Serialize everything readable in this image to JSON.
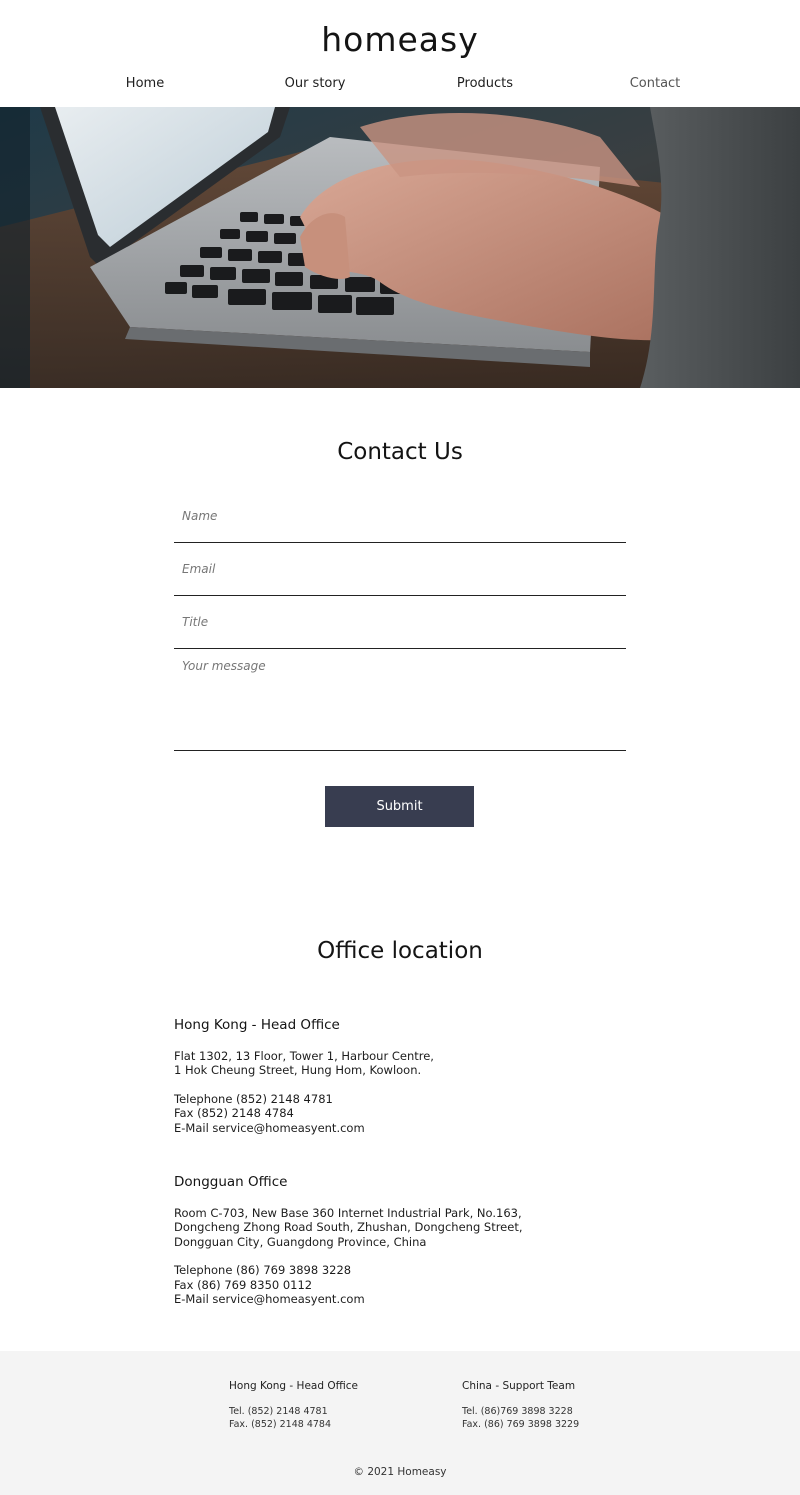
{
  "brand": {
    "logo": "homeasy"
  },
  "nav": {
    "items": [
      {
        "label": "Home"
      },
      {
        "label": "Our story"
      },
      {
        "label": "Products"
      },
      {
        "label": "Contact"
      }
    ]
  },
  "hero": {
    "alt": "hands typing on a laptop keyboard"
  },
  "contact": {
    "title": "Contact Us",
    "fields": {
      "name_placeholder": "Name",
      "email_placeholder": "Email",
      "title_placeholder": "Title",
      "message_placeholder": "Your message"
    },
    "submit_label": "Submit"
  },
  "offices": {
    "title": "Office location",
    "hk": {
      "name": "Hong Kong - Head Office",
      "address1": "Flat 1302, 13 Floor, Tower 1, Harbour Centre,",
      "address2": "1 Hok Cheung Street, Hung Hom, Kowloon.",
      "telephone": "Telephone (852) 2148 4781",
      "fax": "Fax (852) 2148 4784",
      "email": "E-Mail service@homeasyent.com"
    },
    "dg": {
      "name": "Dongguan Office",
      "address1": "Room C-703, New Base 360 Internet Industrial Park, No.163,",
      "address2": "Dongcheng Zhong Road South, Zhushan, Dongcheng Street,",
      "address3": "Dongguan City, Guangdong Province, China",
      "telephone": "Telephone (86) 769 3898 3228",
      "fax": "Fax (86) 769 8350 0112",
      "email": "E-Mail service@homeasyent.com"
    }
  },
  "footer": {
    "hk": {
      "title": "Hong Kong - Head Office",
      "tel": "Tel. (852) 2148 4781",
      "fax": "Fax. (852) 2148 4784"
    },
    "cn": {
      "title": "China - Support Team",
      "tel": "Tel. (86)769 3898 3228",
      "fax": "Fax. (86) 769 3898 3229"
    },
    "copyright": "© 2021 Homeasy"
  }
}
